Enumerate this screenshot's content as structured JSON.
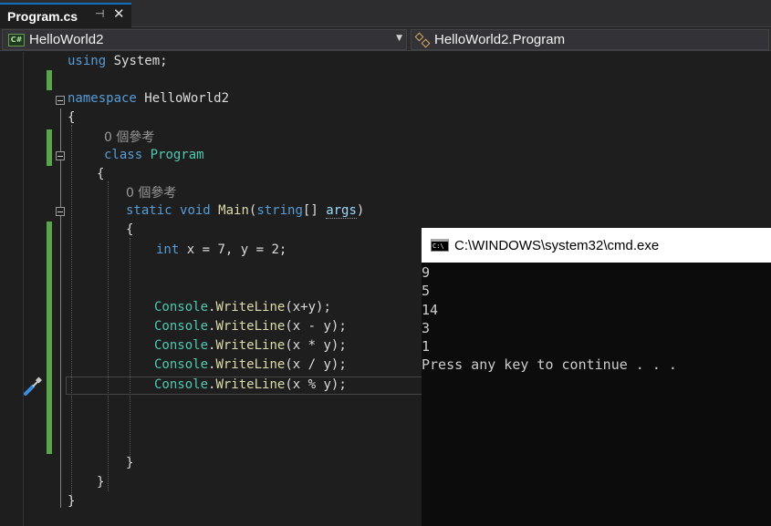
{
  "tab": {
    "title": "Program.cs",
    "pin_icon": "pin-icon",
    "close_icon": "close-icon"
  },
  "nav": {
    "project": "HelloWorld2",
    "project_icon_label": "C#",
    "scope": "HelloWorld2.Program"
  },
  "code": {
    "l1": {
      "kw": "using",
      "rest": " System;"
    },
    "l3": {
      "kw": "namespace",
      "rest": " HelloWorld2"
    },
    "l4": "{",
    "l5_lens": "0 個參考",
    "l6": {
      "kw": "class",
      "ty": "Program"
    },
    "l7": "{",
    "l8_lens": "0 個參考",
    "l9": {
      "kw1": "static",
      "kw2": "void",
      "mt": "Main",
      "p1": "(",
      "kw3": "string",
      "p2": "[] ",
      "param": "args",
      "p3": ")"
    },
    "l10": "{",
    "l11": {
      "kw": "int",
      "rest": " x = 7, y = 2;"
    },
    "writes": [
      {
        "cls": "Console",
        "dot": ".",
        "mt": "WriteLine",
        "args": "(x+y);"
      },
      {
        "cls": "Console",
        "dot": ".",
        "mt": "WriteLine",
        "args": "(x - y);"
      },
      {
        "cls": "Console",
        "dot": ".",
        "mt": "WriteLine",
        "args": "(x * y);"
      },
      {
        "cls": "Console",
        "dot": ".",
        "mt": "WriteLine",
        "args": "(x / y);"
      },
      {
        "cls": "Console",
        "dot": ".",
        "mt": "WriteLine",
        "args": "(x % y);"
      }
    ],
    "l_close_method": "}",
    "l_close_class": "}",
    "l_close_ns": "}"
  },
  "console": {
    "title": "C:\\WINDOWS\\system32\\cmd.exe",
    "icon_label": "C:\\",
    "lines": [
      "9",
      "5",
      "14",
      "3",
      "1",
      "Press any key to continue . . ."
    ]
  },
  "colors": {
    "keyword": "#569cd6",
    "type": "#4ec9b0",
    "method": "#dcdcaa",
    "change_bar": "#57a64a",
    "tab_accent": "#0e70c0"
  }
}
